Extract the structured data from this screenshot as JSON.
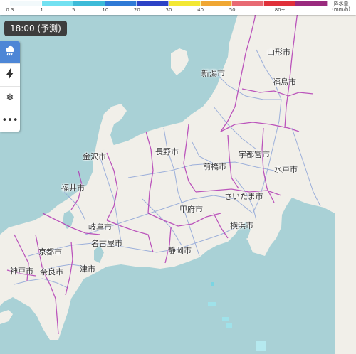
{
  "legend": {
    "colors": [
      "#f2f9fb",
      "#72e1f1",
      "#3dbbd8",
      "#2f7ad6",
      "#2d43c6",
      "#f3e834",
      "#f0a733",
      "#e86a73",
      "#e0303a",
      "#9a2a7e"
    ],
    "ticks": [
      "0.3",
      "1",
      "5",
      "10",
      "20",
      "30",
      "40",
      "50",
      "80~"
    ],
    "unit_line1": "降水量",
    "unit_line2": "(mm/h)"
  },
  "time_label": "18:00 (予測)",
  "side_buttons": [
    {
      "icon": "rain-cloud-icon",
      "active": true
    },
    {
      "icon": "lightning-icon",
      "active": false
    },
    {
      "icon": "snowflake-icon",
      "active": false
    },
    {
      "icon": "more-dots-icon",
      "active": false
    }
  ],
  "cities": {
    "yamagata": "山形市",
    "niigata": "新潟市",
    "fukushima": "福島市",
    "kanazawa": "金沢市",
    "nagano": "長野市",
    "utsunomiya": "宇都宮市",
    "maebashi": "前橋市",
    "mito": "水戸市",
    "fukui": "福井市",
    "saitama": "さいたま市",
    "kofu": "甲府市",
    "gifu": "岐阜市",
    "yokohama": "横浜市",
    "nagoya": "名古屋市",
    "kyoto": "京都市",
    "shizuoka": "静岡市",
    "kobe": "神戸市",
    "nara": "奈良市",
    "tsu": "津市"
  },
  "colors": {
    "sea": "#a9d1d6",
    "land": "#f1efe9",
    "border": "#b23ab4",
    "road": "#8ea5d8",
    "accent": "#4d86d6"
  }
}
